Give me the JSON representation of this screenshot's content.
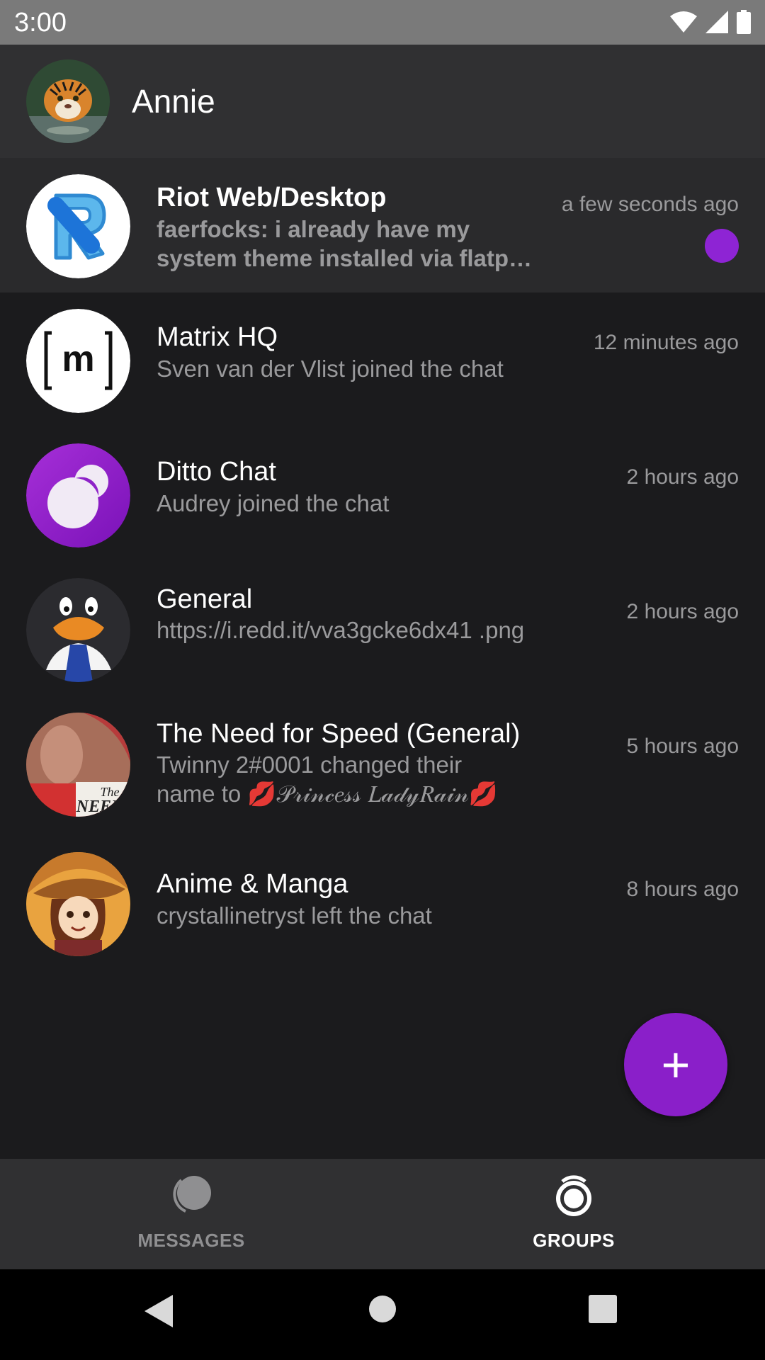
{
  "status_bar": {
    "time": "3:00",
    "icons": [
      "wifi-icon",
      "signal-icon",
      "battery-icon"
    ]
  },
  "header": {
    "user_name": "Annie",
    "avatar_icon": "tiger-avatar"
  },
  "chats": [
    {
      "title": "Riot Web/Desktop",
      "preview": "faerfocks: i already have my system theme installed via flatp…",
      "time": "a few seconds ago",
      "unread": true,
      "avatar_icon": "riot-logo-icon"
    },
    {
      "title": "Matrix HQ",
      "preview": "Sven van der Vlist joined the chat",
      "time": "12 minutes ago",
      "unread": false,
      "avatar_icon": "matrix-logo-icon"
    },
    {
      "title": "Ditto Chat",
      "preview": "Audrey joined the chat",
      "time": "2 hours ago",
      "unread": false,
      "avatar_icon": "ditto-logo-icon"
    },
    {
      "title": "General",
      "preview": "https://i.redd.it/vva3gcke6dx41 .png",
      "time": "2 hours ago",
      "unread": false,
      "avatar_icon": "penguin-avatar-icon"
    },
    {
      "title": "The Need for Speed (General)",
      "preview": "Twinny 2#0001 changed their name to 💋𝒫𝓇𝒾𝓃𝒸𝑒𝓈𝓈 𝐿𝒶𝒹𝓎𝑅𝒶𝒾𝓃💋",
      "time": "5 hours ago",
      "unread": false,
      "avatar_icon": "need-for-speed-avatar-icon"
    },
    {
      "title": "Anime & Manga",
      "preview": "crystallinetryst left the chat",
      "time": "8 hours ago",
      "unread": false,
      "avatar_icon": "anime-girl-avatar-icon"
    }
  ],
  "fab": {
    "icon": "plus-icon",
    "symbol": "+"
  },
  "bottom_nav": {
    "tabs": [
      {
        "label": "MESSAGES",
        "icon": "messages-icon",
        "active": false
      },
      {
        "label": "GROUPS",
        "icon": "groups-icon",
        "active": true
      }
    ]
  },
  "system_nav": {
    "buttons": [
      "back-icon",
      "home-icon",
      "recents-icon"
    ]
  },
  "colors": {
    "accent": "#8a1fc9",
    "background": "#1b1b1d",
    "header": "#303032",
    "status_bar": "#7a7a7a"
  }
}
